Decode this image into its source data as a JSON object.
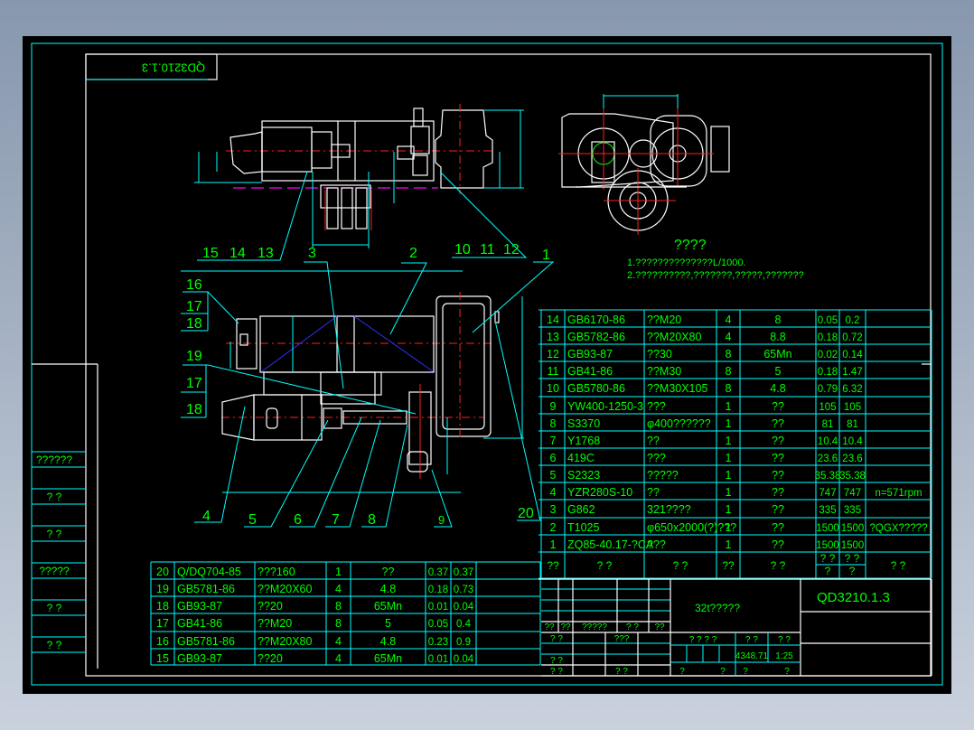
{
  "drawing": {
    "drawing_number": "QD3210.1.3",
    "drawing_number_mirrored": "QD3210.1.3",
    "title": "32t?????",
    "weight": "4348.71",
    "scale": "1:25",
    "notes_heading": "????",
    "notes": [
      "1.??????????????L/1000.",
      "2.??????????,???????,?????,???????"
    ]
  },
  "colors": {
    "background": "#000000",
    "frame": "#ffffff",
    "grid": "#00ffff",
    "text": "#00ff00",
    "centerline": "#ff2020",
    "hidden": "#ff00ff"
  },
  "part_labels": [
    "1",
    "2",
    "3",
    "4",
    "5",
    "6",
    "7",
    "8",
    "9",
    "10",
    "11",
    "12",
    "13",
    "14",
    "15",
    "16",
    "17",
    "18",
    "19",
    "20"
  ],
  "side_labels": {
    "a": "16",
    "b": "17",
    "c": "18",
    "d": "19",
    "e": "17",
    "f": "18"
  },
  "left_column": [
    "??????",
    "?  ?",
    "?  ?",
    "?????",
    "?  ?",
    "?  ?"
  ],
  "parts_list_right": [
    [
      "14",
      "GB6170-86",
      "??M20",
      "4",
      "8",
      "0.05",
      "0.2",
      ""
    ],
    [
      "13",
      "GB5782-86",
      "??M20X80",
      "4",
      "8.8",
      "0.18",
      "0.72",
      ""
    ],
    [
      "12",
      "GB93-87",
      "??30",
      "8",
      "65Mn",
      "0.02",
      "0.14",
      ""
    ],
    [
      "11",
      "GB41-86",
      "??M30",
      "8",
      "5",
      "0.18",
      "1.47",
      ""
    ],
    [
      "10",
      "GB5780-86",
      "??M30X105",
      "8",
      "4.8",
      "0.79",
      "6.32",
      ""
    ],
    [
      "9",
      "YW400-1250-3",
      "???",
      "1",
      "??",
      "105",
      "105",
      ""
    ],
    [
      "8",
      "S3370",
      "φ400??????",
      "1",
      "??",
      "81",
      "81",
      ""
    ],
    [
      "7",
      "Y1768",
      "??",
      "1",
      "??",
      "10.4",
      "10.4",
      ""
    ],
    [
      "6",
      "419C",
      "???",
      "1",
      "??",
      "23.6",
      "23.6",
      ""
    ],
    [
      "5",
      "S2323",
      "?????",
      "1",
      "??",
      "35.38",
      "35.38",
      ""
    ],
    [
      "4",
      "YZR280S-10",
      "??",
      "1",
      "??",
      "747",
      "747",
      "n=571rpm"
    ],
    [
      "3",
      "G862",
      "321????",
      "1",
      "??",
      "335",
      "335",
      ""
    ],
    [
      "2",
      "T1025",
      "φ650x2000(?)???",
      "1",
      "??",
      "1500",
      "1500",
      "?QGX?????"
    ],
    [
      "1",
      "ZQ85-40.17-?CA",
      "???",
      "1",
      "??",
      "1500",
      "1500",
      ""
    ]
  ],
  "parts_list_header": [
    "??",
    "?   ?",
    "?   ?",
    "??",
    "?   ?",
    "? ?",
    "? ?",
    "?",
    "?",
    "?   ?"
  ],
  "parts_list_left": [
    [
      "20",
      "Q/DQ704-85",
      "???160",
      "1",
      "??",
      "0.37",
      "0.37"
    ],
    [
      "19",
      "GB5781-86",
      "??M20X60",
      "4",
      "4.8",
      "0.18",
      "0.73"
    ],
    [
      "18",
      "GB93-87",
      "??20",
      "8",
      "65Mn",
      "0.01",
      "0.04"
    ],
    [
      "17",
      "GB41-86",
      "??M20",
      "8",
      "5",
      "0.05",
      "0.4"
    ],
    [
      "16",
      "GB5781-86",
      "??M20X80",
      "4",
      "4.8",
      "0.23",
      "0.9"
    ],
    [
      "15",
      "GB93-87",
      "??20",
      "4",
      "65Mn",
      "0.01",
      "0.04"
    ]
  ],
  "title_block": {
    "sign_row": [
      "??",
      "??",
      "?????",
      "? ?",
      "??"
    ],
    "left_rows": [
      "? ?",
      "???",
      "? ?",
      "? ?",
      "? ?"
    ],
    "stage_header": "? ? ? ?",
    "weight_header": "? ?",
    "scale_header": "? ?",
    "sheet_left": "?",
    "sheet_mid": "?",
    "sheet_right1": "?",
    "sheet_right2": "?"
  }
}
